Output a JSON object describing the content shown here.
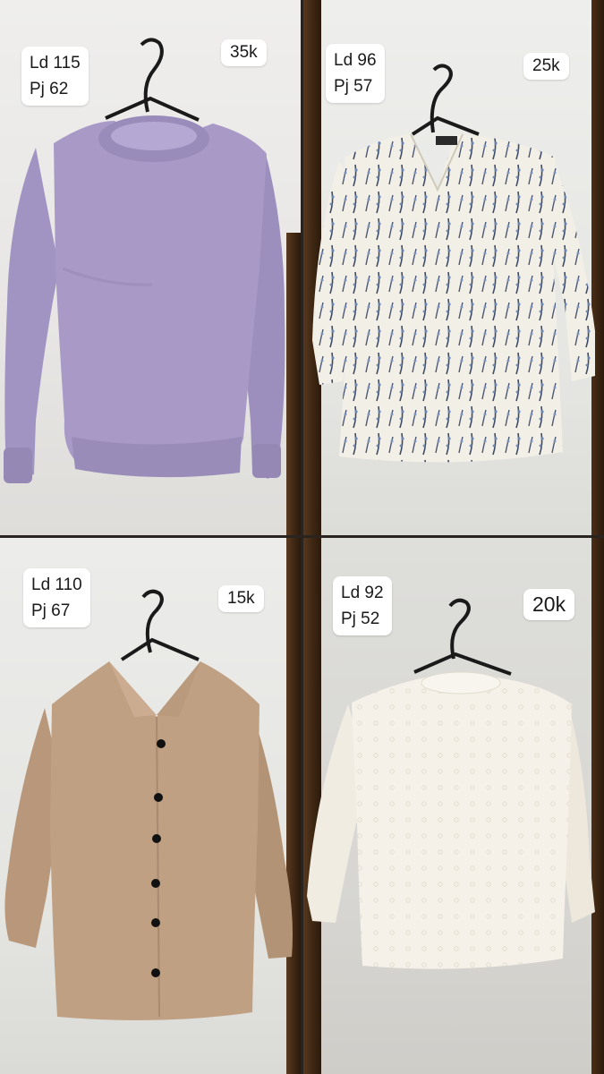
{
  "listings": [
    {
      "size_line1": "Ld 115",
      "size_line2": "Pj 62",
      "price": "35k",
      "garment": "lilac-sweatshirt",
      "color": "#a899c7"
    },
    {
      "size_line1": "Ld 96",
      "size_line2": "Pj 57",
      "price": "25k",
      "garment": "floral-print-blouse",
      "color": "#f2efe6"
    },
    {
      "size_line1": "Ld 110",
      "size_line2": "Pj 67",
      "price": "15k",
      "garment": "tan-button-blouse",
      "color": "#c0a083"
    },
    {
      "size_line1": "Ld 92",
      "size_line2": "Pj 52",
      "price": "20k",
      "garment": "white-lace-blouse",
      "color": "#f5f1e8"
    }
  ]
}
